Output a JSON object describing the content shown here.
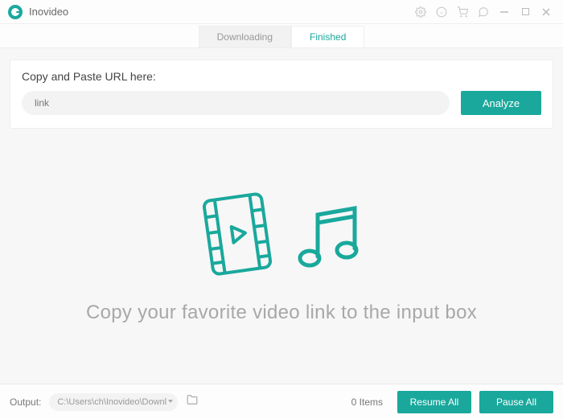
{
  "app": {
    "title": "Inovideo"
  },
  "tabs": {
    "downloading": "Downloading",
    "finished": "Finished",
    "active": "finished"
  },
  "url_panel": {
    "label": "Copy and Paste URL here:",
    "placeholder": "link",
    "analyze_label": "Analyze"
  },
  "content": {
    "tagline": "Copy your favorite video link to the input box"
  },
  "footer": {
    "output_label": "Output:",
    "output_path": "C:\\Users\\ch\\Inovideo\\Downl",
    "items_count": "0 Items",
    "resume_label": "Resume All",
    "pause_label": "Pause All"
  },
  "colors": {
    "accent": "#1aa89c"
  }
}
